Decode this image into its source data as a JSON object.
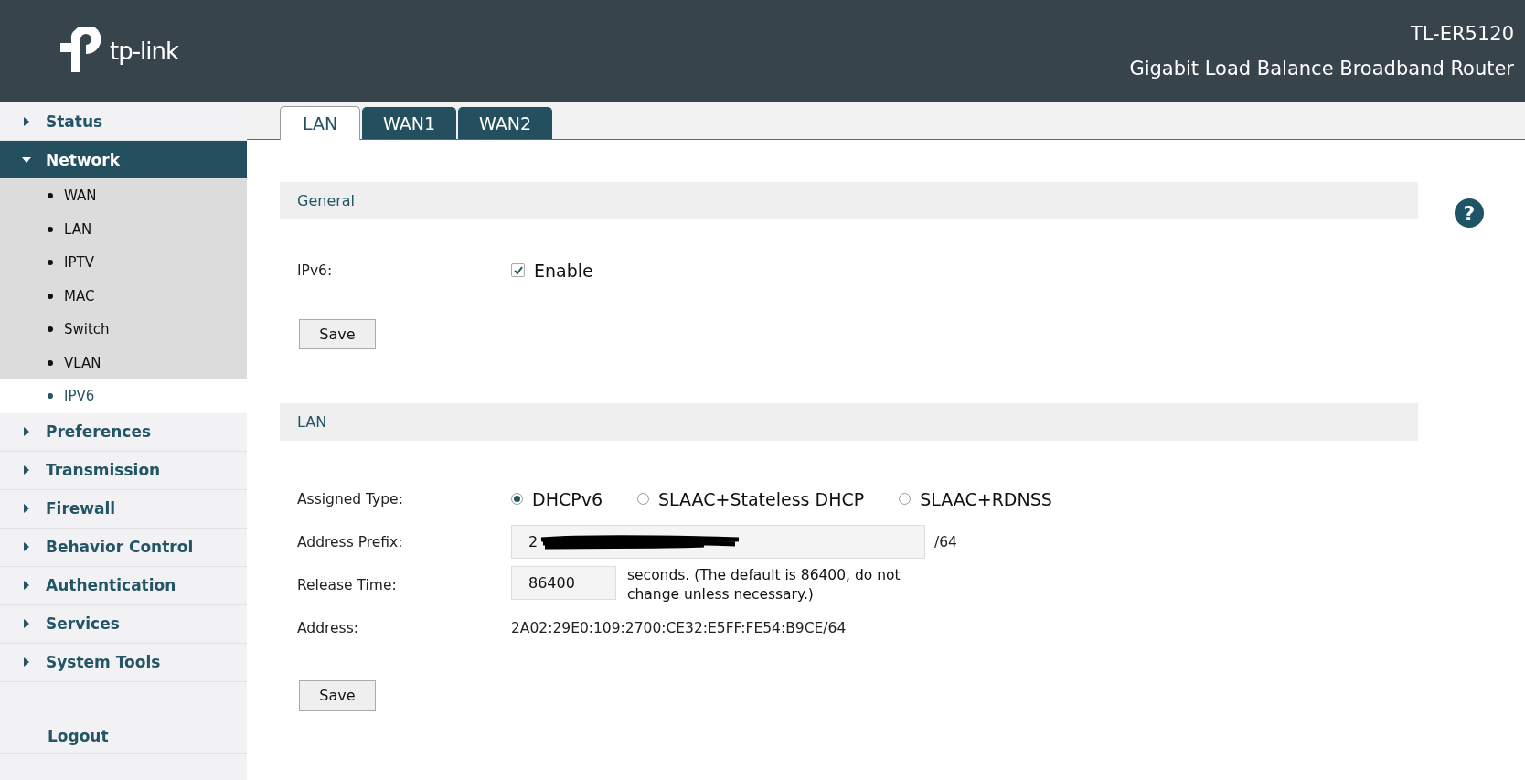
{
  "header": {
    "logo": "tp-link",
    "model": "TL-ER5120",
    "product": "Gigabit Load Balance Broadband Router"
  },
  "sidebar": {
    "items": [
      {
        "label": "Status",
        "expanded": false
      },
      {
        "label": "Network",
        "expanded": true,
        "children": [
          {
            "label": "WAN",
            "selected": false
          },
          {
            "label": "LAN",
            "selected": false
          },
          {
            "label": "IPTV",
            "selected": false
          },
          {
            "label": "MAC",
            "selected": false
          },
          {
            "label": "Switch",
            "selected": false
          },
          {
            "label": "VLAN",
            "selected": false
          },
          {
            "label": "IPV6",
            "selected": true
          }
        ]
      },
      {
        "label": "Preferences",
        "expanded": false
      },
      {
        "label": "Transmission",
        "expanded": false
      },
      {
        "label": "Firewall",
        "expanded": false
      },
      {
        "label": "Behavior Control",
        "expanded": false
      },
      {
        "label": "Authentication",
        "expanded": false
      },
      {
        "label": "Services",
        "expanded": false
      },
      {
        "label": "System Tools",
        "expanded": false
      }
    ],
    "logout": "Logout"
  },
  "tabs": [
    {
      "label": "LAN",
      "selected": true
    },
    {
      "label": "WAN1",
      "selected": false
    },
    {
      "label": "WAN2",
      "selected": false
    }
  ],
  "help": "?",
  "general": {
    "title": "General",
    "ipv6_label": "IPv6:",
    "ipv6_checkbox": {
      "label": "Enable",
      "checked": true
    },
    "save": "Save"
  },
  "lan": {
    "title": "LAN",
    "assigned_type": {
      "label": "Assigned Type:",
      "options": [
        {
          "label": "DHCPv6",
          "selected": true
        },
        {
          "label": "SLAAC+Stateless DHCP",
          "selected": false
        },
        {
          "label": "SLAAC+RDNSS",
          "selected": false
        }
      ]
    },
    "address_prefix": {
      "label": "Address Prefix:",
      "value": "2",
      "suffix": "/64"
    },
    "release_time": {
      "label": "Release Time:",
      "value": "86400",
      "note": "seconds. (The default is 86400, do not change unless necessary.)"
    },
    "address": {
      "label": "Address:",
      "value": "2A02:29E0:109:2700:CE32:E5FF:FE54:B9CE/64"
    },
    "save": "Save"
  }
}
